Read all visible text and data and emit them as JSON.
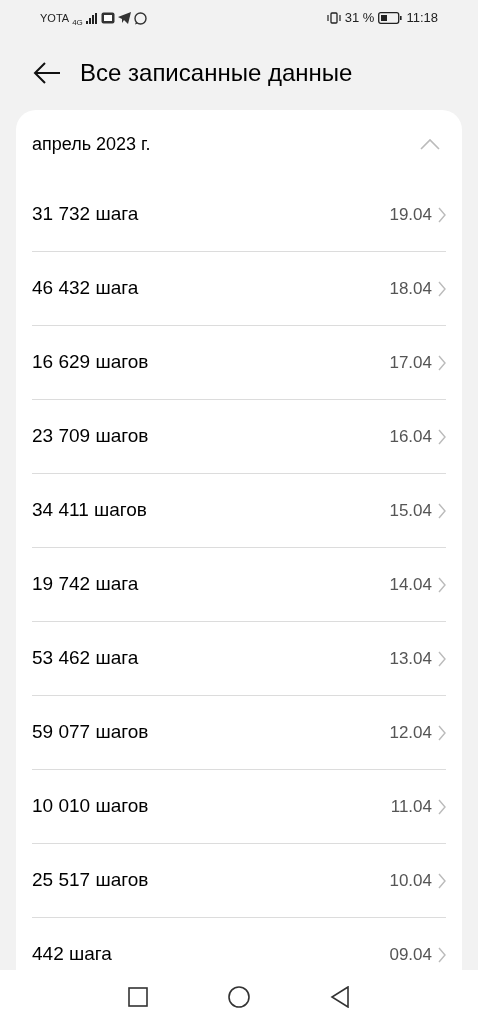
{
  "status_bar": {
    "carrier": "YOTA",
    "network": "4G",
    "battery": "31 %",
    "time": "11:18"
  },
  "header": {
    "title": "Все записанные данные"
  },
  "month": {
    "label": "апрель 2023 г.",
    "expanded": true
  },
  "records": [
    {
      "steps": "31 732 шага",
      "date": "19.04"
    },
    {
      "steps": "46 432 шага",
      "date": "18.04"
    },
    {
      "steps": "16 629 шагов",
      "date": "17.04"
    },
    {
      "steps": "23 709 шагов",
      "date": "16.04"
    },
    {
      "steps": "34 411 шагов",
      "date": "15.04"
    },
    {
      "steps": "19 742 шага",
      "date": "14.04"
    },
    {
      "steps": "53 462 шага",
      "date": "13.04"
    },
    {
      "steps": "59 077 шагов",
      "date": "12.04"
    },
    {
      "steps": "10 010 шагов",
      "date": "11.04"
    },
    {
      "steps": "25 517 шагов",
      "date": "10.04"
    },
    {
      "steps": "442 шага",
      "date": "09.04"
    }
  ]
}
